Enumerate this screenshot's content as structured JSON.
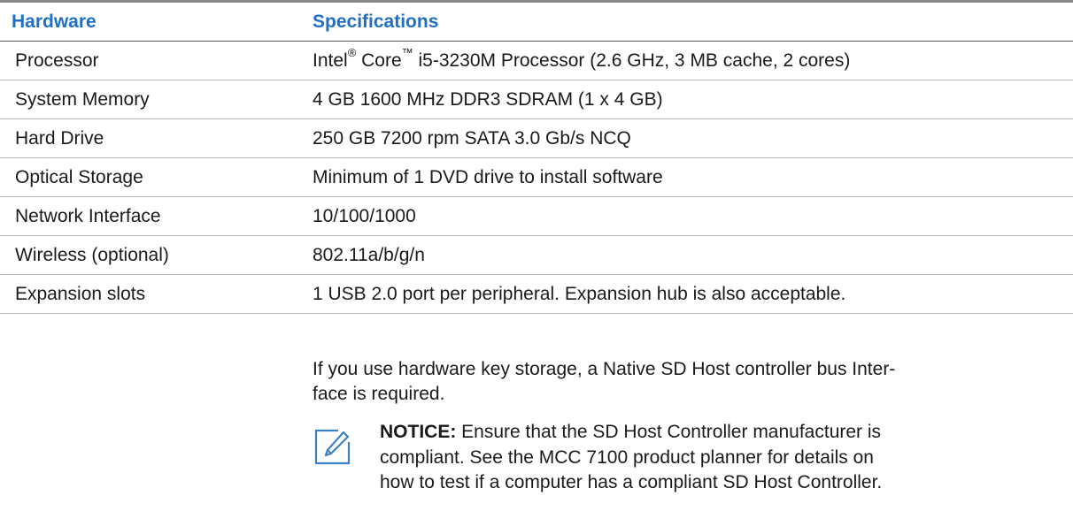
{
  "table": {
    "headers": {
      "hardware": "Hardware",
      "specifications": "Specifications"
    },
    "rows": [
      {
        "hardware": "Processor",
        "spec_parts": [
          "Intel",
          "®",
          " Core",
          "™",
          " i5-3230M Processor (2.6 GHz, 3 MB cache, 2 cores)"
        ]
      },
      {
        "hardware": "System Memory",
        "spec": "4 GB 1600 MHz DDR3 SDRAM (1 x 4 GB)"
      },
      {
        "hardware": "Hard Drive",
        "spec": "250 GB 7200 rpm SATA 3.0 Gb/s NCQ"
      },
      {
        "hardware": "Optical Storage",
        "spec": "Minimum of 1 DVD drive to install software"
      },
      {
        "hardware": "Network Interface",
        "spec": "10/100/1000"
      },
      {
        "hardware": "Wireless (optional)",
        "spec": "802.11a/b/g/n"
      },
      {
        "hardware": "Expansion slots",
        "spec": "1 USB 2.0 port per peripheral. Expansion hub is also acceptable."
      }
    ],
    "extra_line_1": "If you use hardware key storage, a Native SD Host controller bus Inter-",
    "extra_line_2": "face is required."
  },
  "notice": {
    "icon": "note-pencil-icon",
    "label": "NOTICE:",
    "line_1": " Ensure that the SD Host Controller manufacturer is",
    "line_2": "compliant. See the MCC 7100 product planner for details on",
    "line_3": "how to test if a computer has a compliant SD Host Controller."
  },
  "colors": {
    "header_text": "#1f6fc5",
    "rule": "#b8b8b8",
    "icon": "#3b82c4"
  }
}
